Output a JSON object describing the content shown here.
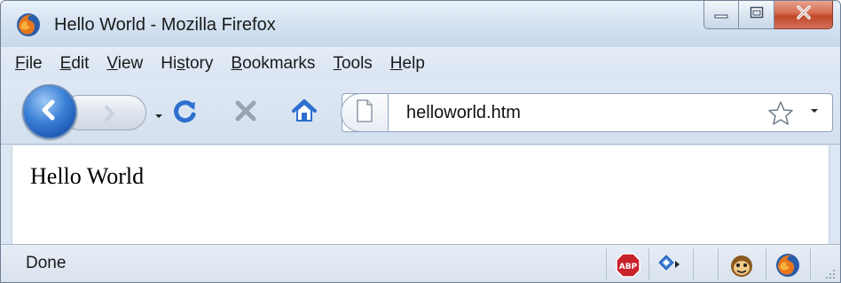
{
  "window": {
    "title": "Hello World - Mozilla Firefox",
    "icon": "firefox-logo-icon"
  },
  "window_controls": {
    "minimize_icon": "minimize-icon",
    "maximize_icon": "maximize-icon",
    "close_icon": "close-icon"
  },
  "menu": {
    "items": [
      {
        "label": "File",
        "accesskey": "F"
      },
      {
        "label": "Edit",
        "accesskey": "E"
      },
      {
        "label": "View",
        "accesskey": "V"
      },
      {
        "label": "History",
        "accesskey": "s"
      },
      {
        "label": "Bookmarks",
        "accesskey": "B"
      },
      {
        "label": "Tools",
        "accesskey": "T"
      },
      {
        "label": "Help",
        "accesskey": "H"
      }
    ]
  },
  "toolbar": {
    "back_icon": "back-arrow-icon",
    "forward_icon": "forward-arrow-icon",
    "history_dropdown_icon": "dropdown-arrow-icon",
    "reload_icon": "reload-icon",
    "stop_icon": "stop-icon",
    "home_icon": "home-icon"
  },
  "address_bar": {
    "value": "helloworld.htm",
    "page_icon": "page-icon",
    "bookmark_icon": "star-icon",
    "dropdown_icon": "dropdown-arrow-icon"
  },
  "page": {
    "body_text": "Hello World"
  },
  "status_bar": {
    "text": "Done",
    "icons": [
      "adblock-plus-icon",
      "add-on-icon",
      "monkey-icon",
      "firefox-icon"
    ]
  },
  "colors": {
    "chrome_bg": "#dde7f3",
    "back_button": "#2f6fcf",
    "reload": "#2e6fd0",
    "stop": "#9aa4b0",
    "close_button": "#c9543a",
    "adblock": "#c8232b"
  }
}
